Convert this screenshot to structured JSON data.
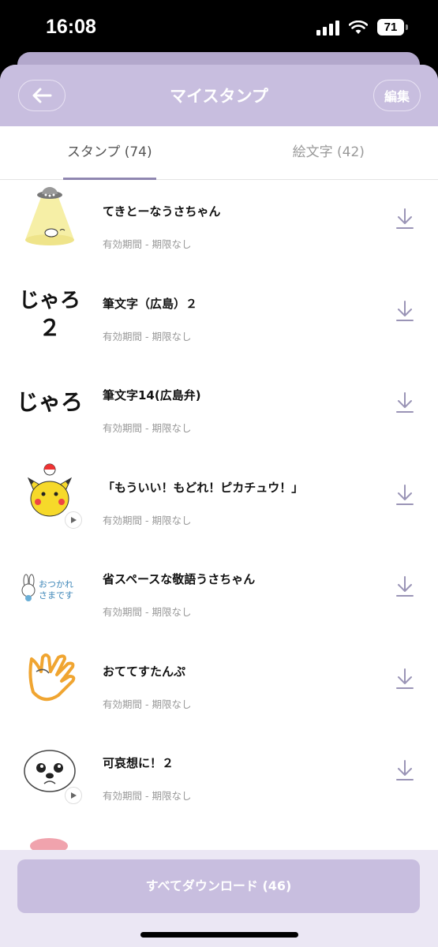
{
  "status": {
    "time": "16:08",
    "battery": "71"
  },
  "header": {
    "title": "マイスタンプ",
    "edit_label": "編集"
  },
  "tabs": [
    {
      "label": "スタンプ (74)",
      "active": true
    },
    {
      "label": "絵文字 (42)",
      "active": false
    }
  ],
  "items": [
    {
      "name": "てきとーなうさちゃん",
      "sub": "有効期間 - 期限なし",
      "icon": "ufo-rabbit-sticker"
    },
    {
      "name": "筆文字（広島）２",
      "sub": "有効期間 - 期限なし",
      "icon": "brush-text-sticker"
    },
    {
      "name": "筆文字14(広島弁)",
      "sub": "有効期間 - 期限なし",
      "icon": "brush-text-sticker"
    },
    {
      "name": "「もういい！もどれ！ピカチュウ！」",
      "sub": "有効期間 - 期限なし",
      "icon": "pikachu-sticker"
    },
    {
      "name": "省スペースな敬語うさちゃん",
      "sub": "有効期間 - 期限なし",
      "icon": "rabbit-sticker"
    },
    {
      "name": "おててすたんぷ",
      "sub": "有効期間 - 期限なし",
      "icon": "hand-sticker"
    },
    {
      "name": "可哀想に！２",
      "sub": "有効期間 - 期限なし",
      "icon": "dog-sticker"
    }
  ],
  "sticker_text": {
    "brush_1": "じゃろ",
    "brush_2": "２",
    "rabbit_1": "おつかれ",
    "rabbit_2": "さまです"
  },
  "download_all_label": "すべてダウンロード (46)",
  "colors": {
    "header": "#c8bedf",
    "accent": "#8f86b0",
    "bottom": "#ebe7f4"
  }
}
